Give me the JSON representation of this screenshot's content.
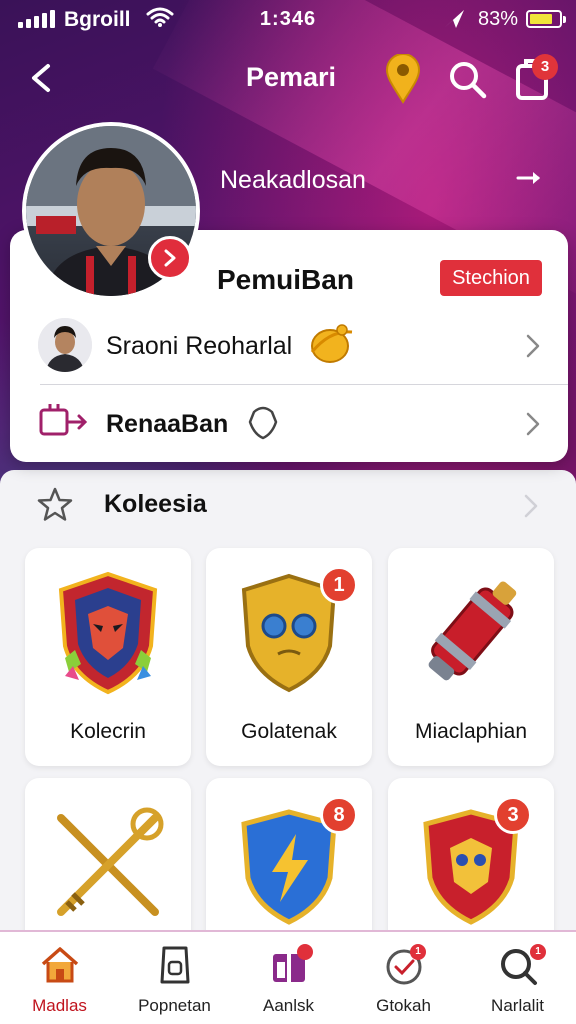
{
  "status_bar": {
    "carrier": "Bgroill",
    "time": "1:346",
    "battery": "83%"
  },
  "header": {
    "title": "Pemari",
    "clipboard_badge": "3"
  },
  "profile": {
    "subtitle": "Neakadlosan",
    "name": "PemuiBan",
    "status_badge": "Stechion"
  },
  "card_rows": [
    {
      "label": "Sraoni Reoharlal",
      "icon": "person-avatar"
    },
    {
      "label": "RenaaBan",
      "icon": "transfer-icon"
    }
  ],
  "section": {
    "title": "Koleesia"
  },
  "tiles": [
    {
      "label": "Kolecrin",
      "badge": "",
      "art": "mask-shield"
    },
    {
      "label": "Golatenak",
      "badge": "1",
      "art": "gold-shield"
    },
    {
      "label": "Miaclaphian",
      "badge": "",
      "art": "red-cylinder"
    },
    {
      "label": "",
      "badge": "",
      "art": "crossed-swords"
    },
    {
      "label": "",
      "badge": "8",
      "art": "lightning-shield"
    },
    {
      "label": "",
      "badge": "3",
      "art": "mask-shield-red"
    }
  ],
  "bottom_nav": [
    {
      "label": "Madlas",
      "icon": "home-icon",
      "active": true
    },
    {
      "label": "Popnetan",
      "icon": "tag-icon",
      "active": false
    },
    {
      "label": "Aanlsk",
      "icon": "gift-icon",
      "active": false
    },
    {
      "label": "Gtokah",
      "icon": "clock-check-icon",
      "active": false
    },
    {
      "label": "Narlalit",
      "icon": "search-chat-icon",
      "active": false
    }
  ],
  "colors": {
    "accent": "#e0303b",
    "nav_active": "#c0141e",
    "badge": "#e2402f"
  }
}
